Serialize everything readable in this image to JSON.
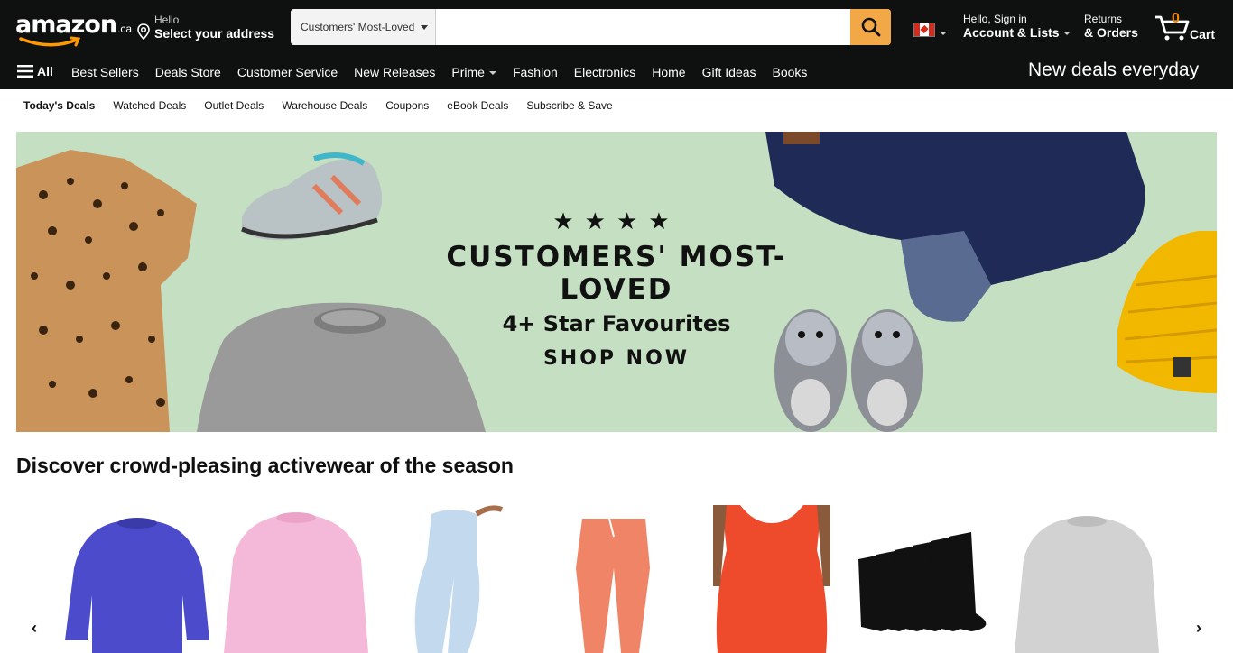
{
  "header": {
    "logo_text": "amazon",
    "logo_tld": ".ca",
    "address_line1": "Hello",
    "address_line2": "Select your address",
    "search_category": "Customers' Most-Loved",
    "search_placeholder": "",
    "account_line1": "Hello, Sign in",
    "account_line2": "Account & Lists",
    "returns_line1": "Returns",
    "returns_line2": "& Orders",
    "cart_count": "0",
    "cart_label": "Cart"
  },
  "nav": {
    "all_label": "All",
    "links": [
      "Best Sellers",
      "Deals Store",
      "Customer Service",
      "New Releases",
      "Prime",
      "Fashion",
      "Electronics",
      "Home",
      "Gift Ideas",
      "Books"
    ],
    "promo": "New deals everyday"
  },
  "subnav": {
    "items": [
      "Today's Deals",
      "Watched Deals",
      "Outlet Deals",
      "Warehouse Deals",
      "Coupons",
      "eBook Deals",
      "Subscribe & Save"
    ]
  },
  "hero": {
    "stars": "★★★★",
    "headline": "CUSTOMERS' MOST-LOVED",
    "subheadline": "4+ Star Favourites",
    "cta": "SHOP NOW"
  },
  "section": {
    "title": "Discover crowd-pleasing activewear of the season"
  },
  "colors": {
    "header_bg": "#0f1111",
    "search_button": "#f3a847",
    "cart_count": "#f08804",
    "hero_bg": "#c4dfc1"
  },
  "icons": {
    "search": "search-icon",
    "location": "location-pin-icon",
    "cart": "cart-icon",
    "menu": "hamburger-menu-icon",
    "prev": "chevron-left-icon",
    "next": "chevron-right-icon"
  }
}
